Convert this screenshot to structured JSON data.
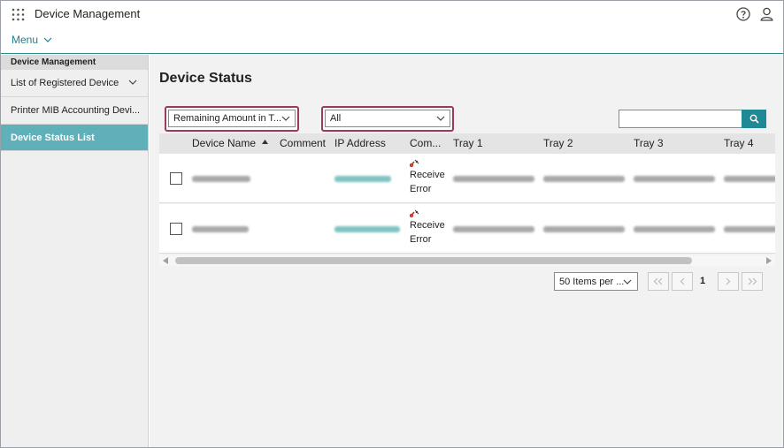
{
  "header": {
    "app_title": "Device Management",
    "menu_label": "Menu"
  },
  "sidebar": {
    "heading": "Device Management",
    "items": [
      {
        "label": "List of Registered Device"
      },
      {
        "label": "Printer MIB Accounting Devi..."
      },
      {
        "label": "Device Status List"
      }
    ]
  },
  "main": {
    "title": "Device Status",
    "filter1": {
      "value": "Remaining Amount in T..."
    },
    "filter2": {
      "value": "All"
    },
    "search": {
      "placeholder": ""
    }
  },
  "table": {
    "columns": [
      "Device Name",
      "Comment",
      "IP Address",
      "Com...",
      "Tray 1",
      "Tray 2",
      "Tray 3",
      "Tray 4"
    ],
    "rows": [
      {
        "status_line1": "Receive",
        "status_line2": "Error"
      },
      {
        "status_line1": "Receive",
        "status_line2": "Error"
      }
    ]
  },
  "pagination": {
    "per_page": "50 Items per ...",
    "current_page": "1"
  },
  "colors": {
    "accent": "#1f8a96",
    "sidebar_active": "#5fb0b8",
    "highlight_border": "#9b3a5d"
  },
  "icons": [
    "apps-grid-icon",
    "help-icon",
    "user-icon",
    "chevron-down-icon",
    "search-icon",
    "sort-up-icon",
    "error-status-icon"
  ]
}
